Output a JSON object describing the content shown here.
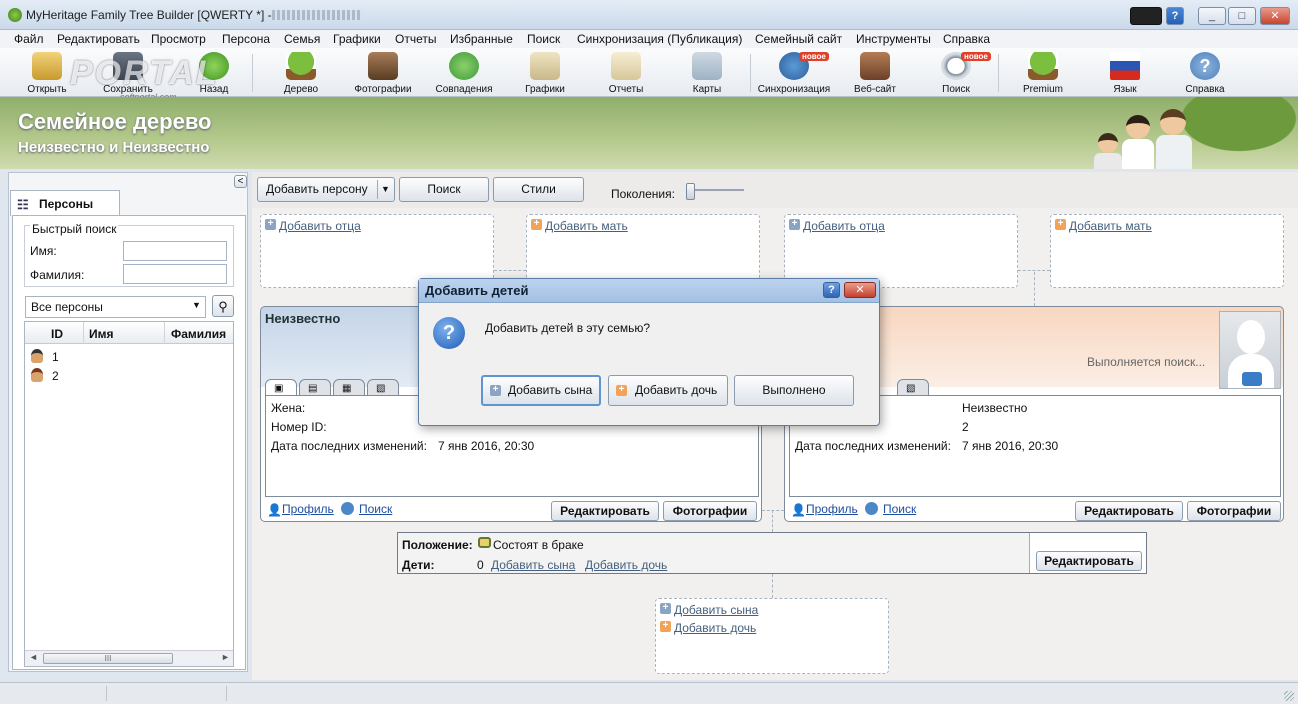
{
  "window": {
    "title": "MyHeritage Family Tree Builder [QWERTY *] - ",
    "minimize": "_",
    "maximize": "□",
    "close": "✕",
    "help": "?"
  },
  "watermark": {
    "brand": "PORTAL",
    "site": "softportal.com"
  },
  "menu": [
    "Файл",
    "Редактировать",
    "Просмотр",
    "Персона",
    "Семья",
    "Графики",
    "Отчеты",
    "Избранные",
    "Поиск",
    "Синхронизация (Публикация)",
    "Семейный сайт",
    "Инструменты",
    "Справка"
  ],
  "toolbar": {
    "items": [
      "Открыть",
      "Сохранить",
      "Назад",
      "Дерево",
      "Фотографии",
      "Совпадения",
      "Графики",
      "Отчеты",
      "Карты",
      "Синхронизация",
      "Веб-сайт",
      "Поиск",
      "Premium",
      "Язык",
      "Справка"
    ],
    "new_badge": "новое"
  },
  "banner": {
    "title": "Семейное дерево",
    "subtitle": "Неизвестно и Неизвестно"
  },
  "sidebar": {
    "tab": "Персоны",
    "collapse": "<",
    "quick_search": "Быстрый поиск",
    "first_name_label": "Имя:",
    "last_name_label": "Фамилия:",
    "filter": "Все персоны",
    "columns": [
      "ID",
      "Имя",
      "Фамилия"
    ],
    "rows": [
      {
        "id": "1"
      },
      {
        "id": "2"
      }
    ],
    "scroll_mid": "III"
  },
  "actions": {
    "add_person": "Добавить персону",
    "search": "Поиск",
    "styles": "Стили",
    "generations": "Поколения:"
  },
  "tree": {
    "add_father": "Добавить отца",
    "add_mother": "Добавить мать",
    "left_person": {
      "name": "Неизвестно",
      "wife_label": "Жена:",
      "id_label": "Номер ID:",
      "changed_label": "Дата последних изменений:",
      "changed_value": "7 янв 2016, 20:30"
    },
    "right_person": {
      "searching": "Выполняется поиск...",
      "wife_value": "Неизвестно",
      "id_value": "2",
      "changed_label": "Дата последних изменений:",
      "changed_value": "7 янв 2016, 20:30"
    },
    "profile": "Профиль",
    "search": "Поиск",
    "edit": "Редактировать",
    "photos": "Фотографии",
    "family": {
      "status_label": "Положение:",
      "status_value": "Состоят в браке",
      "children_label": "Дети:",
      "children_count": "0",
      "add_son": "Добавить сына",
      "add_daughter": "Добавить дочь",
      "edit": "Редактировать"
    },
    "children_box": {
      "add_son": "Добавить сына",
      "add_daughter": "Добавить дочь"
    }
  },
  "dialog": {
    "title": "Добавить детей",
    "message": "Добавить детей в эту семью?",
    "add_son": "Добавить сына",
    "add_daughter": "Добавить дочь",
    "done": "Выполнено",
    "help": "?",
    "close": "✕"
  }
}
